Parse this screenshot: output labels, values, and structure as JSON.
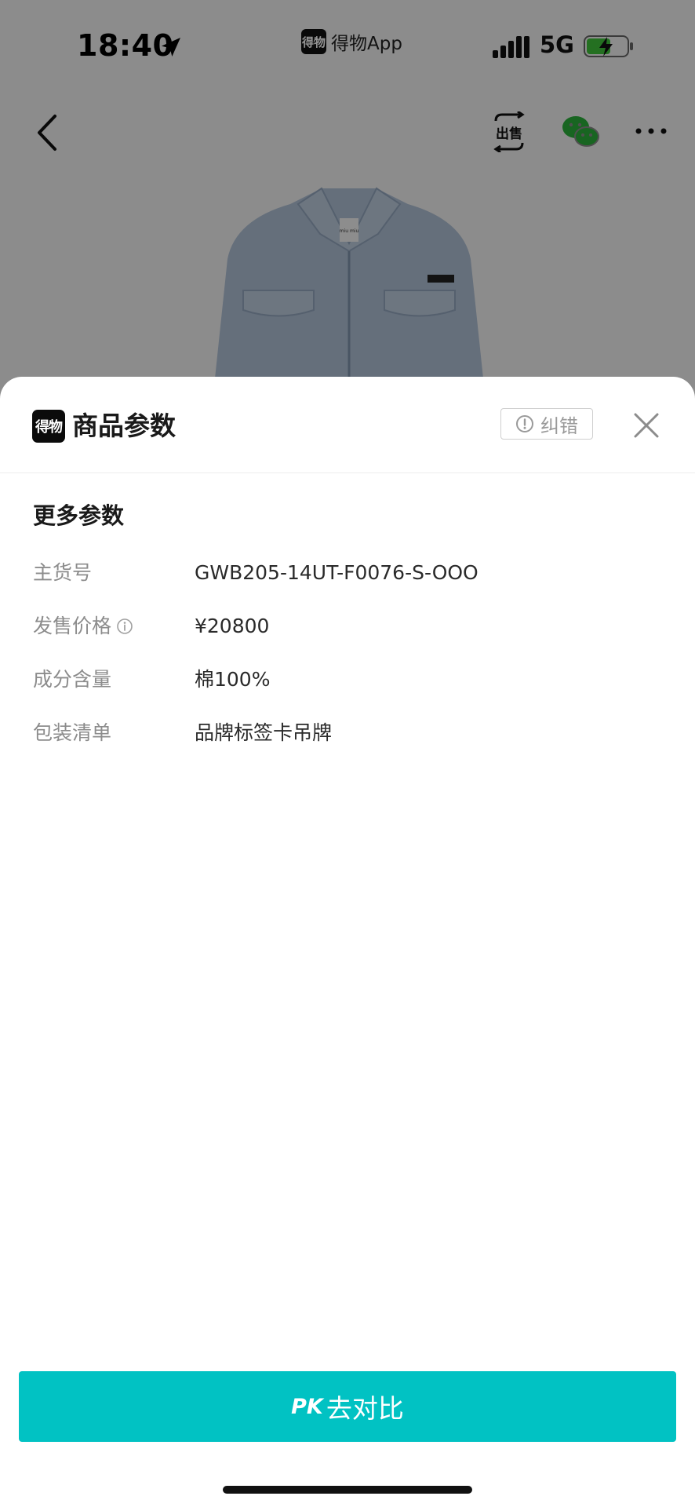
{
  "status_bar": {
    "time": "18:40",
    "app_logo": "得物",
    "app_name": "得物App",
    "network": "5G"
  },
  "nav": {
    "icons": [
      "back-icon",
      "sell-icon",
      "wechat-icon",
      "more-icon"
    ],
    "sell_icon_text": "出售"
  },
  "product": {
    "label_text": "miu miu"
  },
  "sheet": {
    "logo": "得物",
    "title": "商品参数",
    "report_label": "纠错",
    "section_title": "更多参数",
    "params": [
      {
        "label": "主货号",
        "value": "GWB205-14UT-F0076-S-OOO"
      },
      {
        "label": "发售价格",
        "value": "¥20800"
      },
      {
        "label": "成分含量",
        "value": "棉100%"
      },
      {
        "label": "包装清单",
        "value": "品牌标签卡吊牌"
      }
    ]
  },
  "footer": {
    "pk_tag": "PK",
    "pk_label": "去对比"
  },
  "colors": {
    "accent": "#01c2c3",
    "overlay": "rgba(0,0,0,0.42)",
    "battery_charge": "#3ec23a",
    "wechat": "#2aae3a"
  }
}
